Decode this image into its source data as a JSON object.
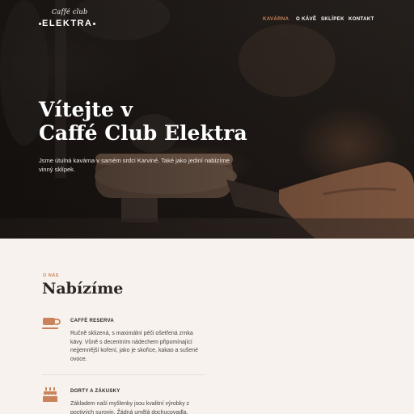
{
  "brand": {
    "script": "Caffé club",
    "word": "ELEKTRA"
  },
  "nav": {
    "items": [
      "KAVÁRNA",
      "O KÁVĚ",
      "SKLÍPEK",
      "KONTAKT"
    ],
    "active": "KAVÁRNA"
  },
  "hero": {
    "title_line1": "Vítejte v",
    "title_line2": "Caffé Club Elektra",
    "text": "Jsme útulná kavárna v samém srdci Karviné. Také jako jediní nabízíme vinný sklípek."
  },
  "about": {
    "kicker": "O NÁS",
    "title": "Nabízíme",
    "offers": [
      {
        "icon": "coffee-cup-icon",
        "title": "CAFFÈ RESERVA",
        "text": "Ručně sklizená, s maximální péči ošetřená zrnka kávy. Vůně s decentním nádechem připomínající nejjemnější koření, jako je skořice, kakao a sušené ovoce."
      },
      {
        "icon": "cake-icon",
        "title": "DORTY A ZÁKUSKY",
        "text": "Základem naší myšlenky jsou kvalitní výrobky z poctivých surovin. Žádná umělá dochucovadla,"
      }
    ]
  },
  "colors": {
    "accent": "#c9825a",
    "background": "#f7f2ee",
    "text_dark": "#2a2522"
  }
}
